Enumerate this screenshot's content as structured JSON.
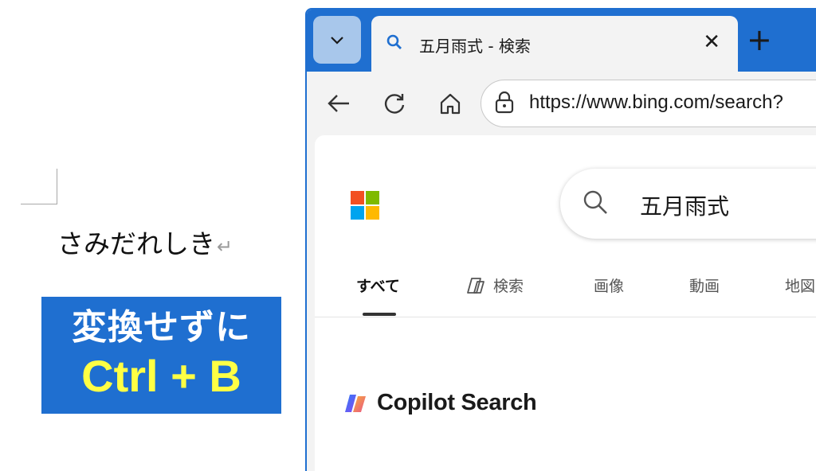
{
  "document": {
    "text": "さみだれしき",
    "return_mark": "↵"
  },
  "callout": {
    "line1": "変換せずに",
    "line2": "Ctrl + B"
  },
  "browser": {
    "tab_list_icon": "chevron-down-icon",
    "tab": {
      "title": "五月雨式 - 検索",
      "icon": "search-icon",
      "close": "✕"
    },
    "new_tab": "+",
    "url": "https://www.bing.com/search?",
    "nav": {
      "back": "←",
      "refresh": "↻",
      "home": "⌂"
    }
  },
  "bing": {
    "query": "五月雨式",
    "tabs": [
      {
        "label": "すべて"
      },
      {
        "label": "検索"
      },
      {
        "label": "画像"
      },
      {
        "label": "動画"
      },
      {
        "label": "地図"
      }
    ],
    "copilot_label": "Copilot Search"
  },
  "colors": {
    "accent": "#1f6fd0",
    "callout_highlight": "#ffff44",
    "ms_red": "#f25022",
    "ms_green": "#7fba00",
    "ms_blue": "#00a4ef",
    "ms_yellow": "#ffb900"
  }
}
